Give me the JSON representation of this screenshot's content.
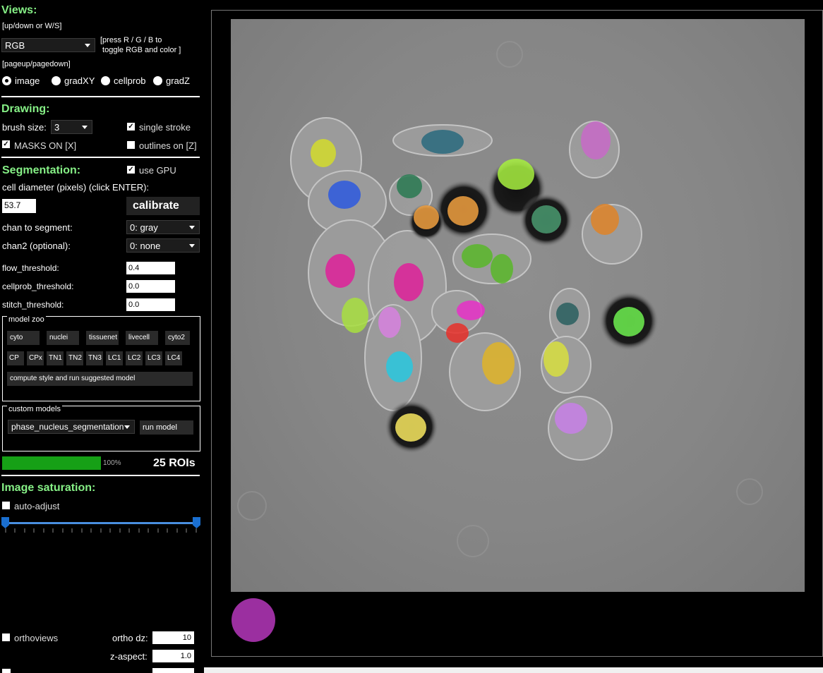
{
  "views": {
    "header": "Views:",
    "hint_updown": "[up/down or W/S]",
    "view_select": "RGB",
    "hint_rgb_line1": "[press R / G / B to",
    "hint_rgb_line2": " toggle RGB and color ]",
    "hint_page": "[pageup/pagedown]",
    "radios": [
      {
        "label": "image",
        "selected": true
      },
      {
        "label": "gradXY",
        "selected": false
      },
      {
        "label": "cellprob",
        "selected": false
      },
      {
        "label": "gradZ",
        "selected": false
      }
    ]
  },
  "drawing": {
    "header": "Drawing:",
    "brush_label": "brush size:",
    "brush_value": "3",
    "single_stroke": {
      "label": "single stroke",
      "checked": true
    },
    "masks_on": {
      "label": "MASKS ON [X]",
      "checked": true
    },
    "outlines_on": {
      "label": "outlines on [Z]",
      "checked": false
    }
  },
  "segmentation": {
    "header": "Segmentation:",
    "use_gpu": {
      "label": "use GPU",
      "checked": true
    },
    "diameter_label": "cell diameter (pixels) (click ENTER):",
    "diameter_value": "53.7",
    "calibrate_label": "calibrate",
    "chan_label": "chan to segment:",
    "chan_value": "0: gray",
    "chan2_label": "chan2 (optional):",
    "chan2_value": "0: none",
    "flow_label": "flow_threshold:",
    "flow_value": "0.4",
    "cellprob_label": "cellprob_threshold:",
    "cellprob_value": "0.0",
    "stitch_label": "stitch_threshold:",
    "stitch_value": "0.0"
  },
  "model_zoo": {
    "title": "model zoo",
    "row1": [
      "cyto",
      "nuclei",
      "tissuenet",
      "livecell",
      "cyto2"
    ],
    "row2": [
      "CP",
      "CPx",
      "TN1",
      "TN2",
      "TN3",
      "LC1",
      "LC2",
      "LC3",
      "LC4"
    ],
    "suggest_label": "compute style and run suggested model"
  },
  "custom_models": {
    "title": "custom models",
    "selected": "phase_nucleus_segmentation",
    "run_label": "run model"
  },
  "progress": {
    "percent": 100,
    "percent_label": "100%",
    "roi_count": "25 ROIs"
  },
  "saturation": {
    "header": "Image saturation:",
    "auto_adjust": {
      "label": "auto-adjust",
      "checked": false
    },
    "low": 0.0,
    "high": 1.0
  },
  "ortho": {
    "orthoviews_label": "orthoviews",
    "orthoviews_checked": false,
    "dz_label": "ortho dz:",
    "dz_value": "10",
    "zaspect_label": "z-aspect:",
    "zaspect_value": "1.0"
  },
  "colors": {
    "header_green": "#86f086",
    "progress_green": "#16a016",
    "slider_blue": "#1a6fd0",
    "brush_preview": "#9b2fa0"
  }
}
